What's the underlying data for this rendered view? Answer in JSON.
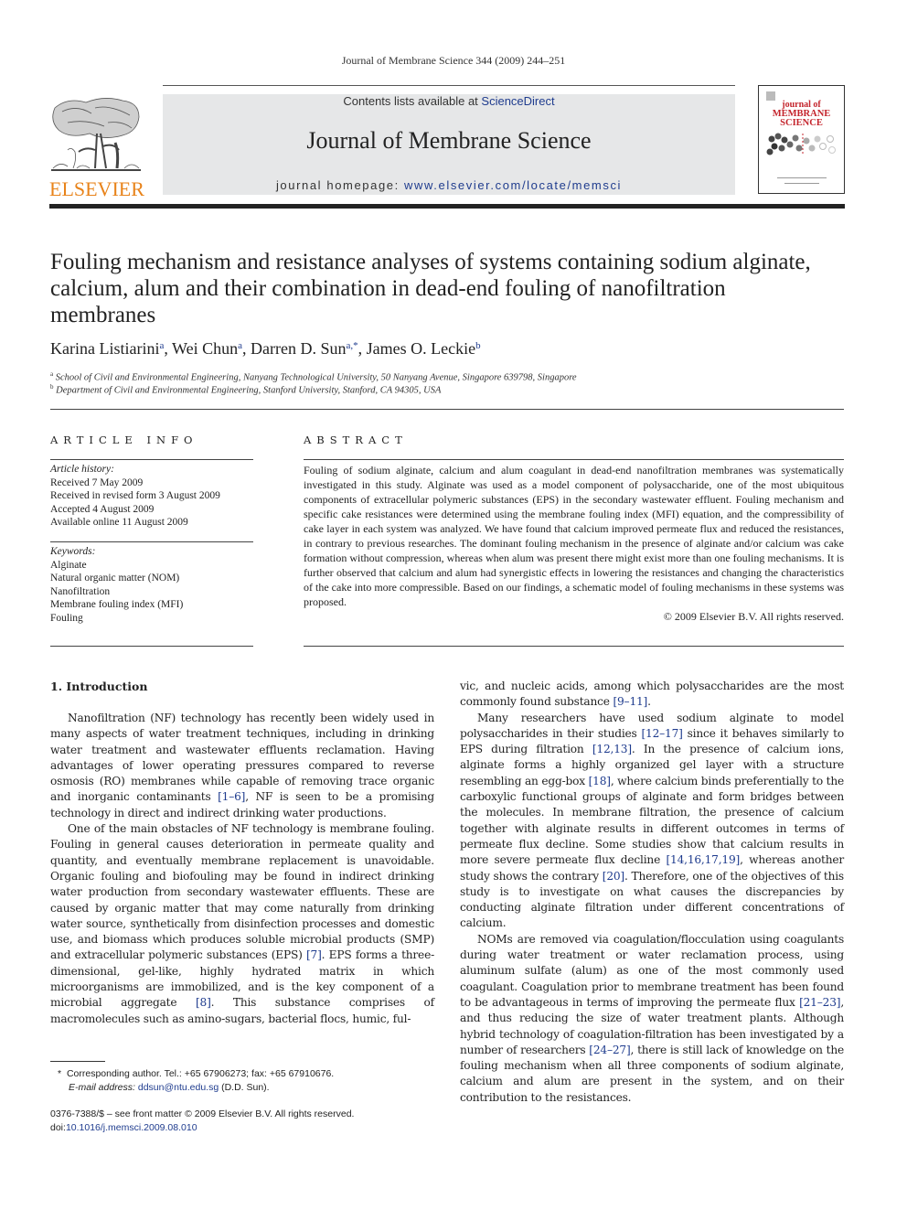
{
  "running_head": "Journal of Membrane Science 344 (2009) 244–251",
  "masthead": {
    "publisher_logo_text": "ELSEVIER",
    "contents_prefix": "Contents lists available at ",
    "contents_link": "ScienceDirect",
    "journal_title": "Journal of Membrane Science",
    "homepage_prefix": "journal homepage: ",
    "homepage_link": "www.elsevier.com/locate/memsci",
    "cover_title_lines": [
      "journal of",
      "MEMBRANE",
      "SCIENCE"
    ],
    "brand_color": "#e8831a",
    "link_color": "#1f3c8e",
    "cover_title_color": "#c4242c"
  },
  "article": {
    "title": "Fouling mechanism and resistance analyses of systems containing sodium alginate, calcium, alum and their combination in dead-end fouling of nanofiltration membranes",
    "authors": [
      {
        "name": "Karina Listiarini",
        "sup": "a"
      },
      {
        "name": "Wei Chun",
        "sup": "a"
      },
      {
        "name": "Darren D. Sun",
        "sup": "a,*"
      },
      {
        "name": "James O. Leckie",
        "sup": "b"
      }
    ],
    "affiliations": [
      {
        "sup": "a",
        "text": "School of Civil and Environmental Engineering, Nanyang Technological University, 50 Nanyang Avenue, Singapore 639798, Singapore"
      },
      {
        "sup": "b",
        "text": "Department of Civil and Environmental Engineering, Stanford University, Stanford, CA 94305, USA"
      }
    ]
  },
  "article_info": {
    "heading": "ARTICLE INFO",
    "history_label": "Article history:",
    "history": [
      "Received 7 May 2009",
      "Received in revised form 3 August 2009",
      "Accepted 4 August 2009",
      "Available online 11 August 2009"
    ],
    "keywords_label": "Keywords:",
    "keywords": [
      "Alginate",
      "Natural organic matter (NOM)",
      "Nanofiltration",
      "Membrane fouling index (MFI)",
      "Fouling"
    ]
  },
  "abstract": {
    "heading": "ABSTRACT",
    "text": "Fouling of sodium alginate, calcium and alum coagulant in dead-end nanofiltration membranes was systematically investigated in this study. Alginate was used as a model component of polysaccharide, one of the most ubiquitous components of extracellular polymeric substances (EPS) in the secondary wastewater effluent. Fouling mechanism and specific cake resistances were determined using the membrane fouling index (MFI) equation, and the compressibility of cake layer in each system was analyzed. We have found that calcium improved permeate flux and reduced the resistances, in contrary to previous researches. The dominant fouling mechanism in the presence of alginate and/or calcium was cake formation without compression, whereas when alum was present there might exist more than one fouling mechanisms. It is further observed that calcium and alum had synergistic effects in lowering the resistances and changing the characteristics of the cake into more compressible. Based on our findings, a schematic model of fouling mechanisms in these systems was proposed.",
    "copyright": "© 2009 Elsevier B.V. All rights reserved."
  },
  "body": {
    "section_heading": "1.  Introduction",
    "left_paragraphs": [
      [
        {
          "t": "Nanofiltration (NF) technology has recently been widely used in many aspects of water treatment techniques, including in drinking water treatment and wastewater effluents reclamation. Having advantages of lower operating pressures compared to reverse osmosis (RO) membranes while capable of removing trace organic and inorganic contaminants "
        },
        {
          "r": "[1–6]"
        },
        {
          "t": ", NF is seen to be a promising technology in direct and indirect drinking water productions."
        }
      ],
      [
        {
          "t": "One of the main obstacles of NF technology is membrane fouling. Fouling in general causes deterioration in permeate quality and quantity, and eventually membrane replacement is unavoidable. Organic fouling and biofouling may be found in indirect drinking water production from secondary wastewater effluents. These are caused by organic matter that may come naturally from drinking water source, synthetically from disinfection processes and domestic use, and biomass which produces soluble microbial products (SMP) and extracellular polymeric substances (EPS) "
        },
        {
          "r": "[7]"
        },
        {
          "t": ". EPS forms a three-dimensional, gel-like, highly hydrated matrix in which microorganisms are immobilized, and is the key component of a microbial aggregate "
        },
        {
          "r": "[8]"
        },
        {
          "t": ". This substance comprises of macromolecules such as amino-sugars, bacterial flocs, humic, ful-"
        }
      ]
    ],
    "right_paragraphs": [
      [
        {
          "t": "vic, and nucleic acids, among which polysaccharides are the most commonly found substance "
        },
        {
          "r": "[9–11]"
        },
        {
          "t": "."
        }
      ],
      [
        {
          "t": "Many researchers have used sodium alginate to model polysaccharides in their studies "
        },
        {
          "r": "[12–17]"
        },
        {
          "t": " since it behaves similarly to EPS during filtration "
        },
        {
          "r": "[12,13]"
        },
        {
          "t": ". In the presence of calcium ions, alginate forms a highly organized gel layer with a structure resembling an egg-box "
        },
        {
          "r": "[18]"
        },
        {
          "t": ", where calcium binds preferentially to the carboxylic functional groups of alginate and form bridges between the molecules. In membrane filtration, the presence of calcium together with alginate results in different outcomes in terms of permeate flux decline. Some studies show that calcium results in more severe permeate flux decline "
        },
        {
          "r": "[14,16,17,19]"
        },
        {
          "t": ", whereas another study shows the contrary "
        },
        {
          "r": "[20]"
        },
        {
          "t": ". Therefore, one of the objectives of this study is to investigate on what causes the discrepancies by conducting alginate filtration under different concentrations of calcium."
        }
      ],
      [
        {
          "t": "NOMs are removed via coagulation/flocculation using coagulants during water treatment or water reclamation process, using aluminum sulfate (alum) as one of the most commonly used coagulant. Coagulation prior to membrane treatment has been found to be advantageous in terms of improving the permeate flux "
        },
        {
          "r": "[21–23]"
        },
        {
          "t": ", and thus reducing the size of water treatment plants. Although hybrid technology of coagulation-filtration has been investigated by a number of researchers "
        },
        {
          "r": "[24–27]"
        },
        {
          "t": ", there is still lack of knowledge on the fouling mechanism when all three components of sodium alginate, calcium and alum are present in the system, and on their contribution to the resistances."
        }
      ]
    ]
  },
  "footnotes": {
    "corresponding_mark": "*",
    "corresponding": "Corresponding author. Tel.: +65 67906273; fax: +65 67910676.",
    "email_label": "E-mail address: ",
    "email": "ddsun@ntu.edu.sg",
    "email_suffix": " (D.D. Sun).",
    "issn_line": "0376-7388/$ – see front matter © 2009 Elsevier B.V. All rights reserved.",
    "doi_label": "doi:",
    "doi": "10.1016/j.memsci.2009.08.010"
  }
}
